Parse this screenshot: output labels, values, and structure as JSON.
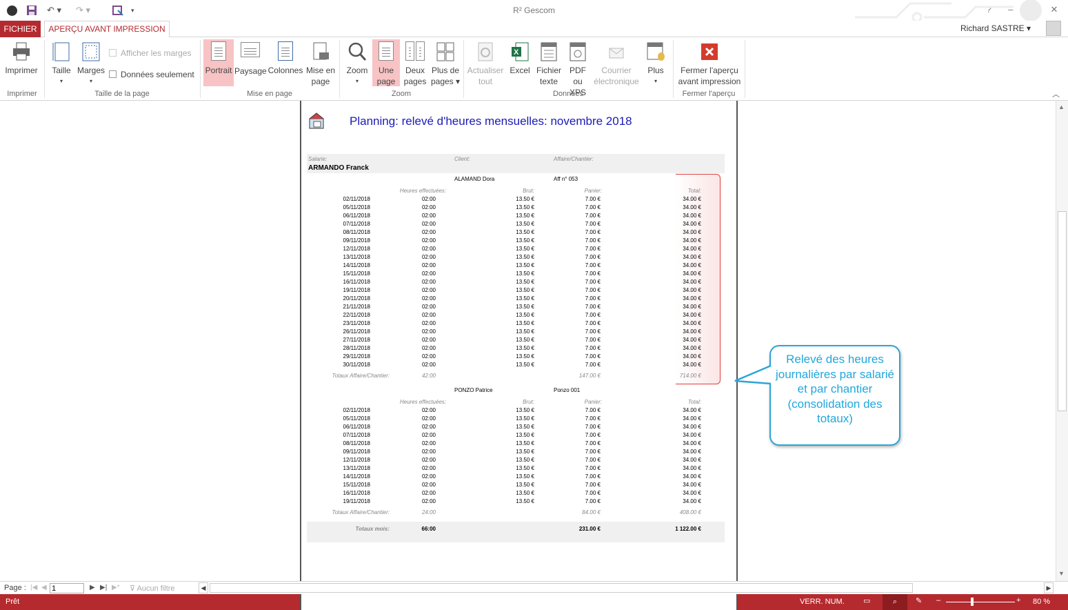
{
  "titlebar": {
    "app_title": "R² Gescom",
    "help": "?",
    "minimize": "–",
    "restore": "☐",
    "close": "✕"
  },
  "tabs": {
    "file": "FICHIER",
    "preview": "APERÇU AVANT IMPRESSION"
  },
  "user": {
    "name": "Richard SASTRE"
  },
  "ribbon": {
    "print": {
      "label": "Imprimer",
      "group": "Imprimer"
    },
    "size": {
      "label": "Taille",
      "group": "Taille de la page"
    },
    "margins": {
      "label": "Marges"
    },
    "show_margins": "Afficher les marges",
    "data_only": "Données seulement",
    "portrait": "Portrait",
    "landscape": "Paysage",
    "columns": "Colonnes",
    "page_setup_l1": "Mise en",
    "page_setup_l2": "page",
    "layout_group": "Mise en page",
    "zoom": "Zoom",
    "one_page_l1": "Une",
    "one_page_l2": "page",
    "two_pages_l1": "Deux",
    "two_pages_l2": "pages",
    "more_pages_l1": "Plus de",
    "more_pages_l2": "pages",
    "zoom_group": "Zoom",
    "refresh_l1": "Actualiser",
    "refresh_l2": "tout",
    "excel": "Excel",
    "text_file_l1": "Fichier",
    "text_file_l2": "texte",
    "pdf_l1": "PDF",
    "pdf_l2": "ou XPS",
    "email_l1": "Courrier",
    "email_l2": "électronique",
    "more": "Plus",
    "data_group": "Données",
    "close_l1": "Fermer l'aperçu",
    "close_l2": "avant impression",
    "close_group": "Fermer l'aperçu"
  },
  "report": {
    "title": "Planning: relevé d'heures mensuelles:  novembre 2018",
    "salarie_label": "Salarie:",
    "client_label": "Client:",
    "affaire_label": "Affaire/Chantier:",
    "employee": "ARMANDO Franck",
    "col_hours": "Heures effectuées:",
    "col_brut": "Brut:",
    "col_panier": "Panier:",
    "col_total": "Total:",
    "totals_label": "Totaux Affaire/Chantier:",
    "month_label": "Totaux mois:",
    "month_hours": "66:00",
    "month_panier": "231.00 €",
    "month_total": "1 122.00 €",
    "sections": [
      {
        "client": "ALAMAND Dora",
        "affaire": "Aff n° 053",
        "rows": [
          [
            "02/11/2018",
            "02:00",
            "13.50 €",
            "7.00 €",
            "34.00 €"
          ],
          [
            "05/11/2018",
            "02:00",
            "13.50 €",
            "7.00 €",
            "34.00 €"
          ],
          [
            "06/11/2018",
            "02:00",
            "13.50 €",
            "7.00 €",
            "34.00 €"
          ],
          [
            "07/11/2018",
            "02:00",
            "13.50 €",
            "7.00 €",
            "34.00 €"
          ],
          [
            "08/11/2018",
            "02:00",
            "13.50 €",
            "7.00 €",
            "34.00 €"
          ],
          [
            "09/11/2018",
            "02:00",
            "13.50 €",
            "7.00 €",
            "34.00 €"
          ],
          [
            "12/11/2018",
            "02:00",
            "13.50 €",
            "7.00 €",
            "34.00 €"
          ],
          [
            "13/11/2018",
            "02:00",
            "13.50 €",
            "7.00 €",
            "34.00 €"
          ],
          [
            "14/11/2018",
            "02:00",
            "13.50 €",
            "7.00 €",
            "34.00 €"
          ],
          [
            "15/11/2018",
            "02:00",
            "13.50 €",
            "7.00 €",
            "34.00 €"
          ],
          [
            "16/11/2018",
            "02:00",
            "13.50 €",
            "7.00 €",
            "34.00 €"
          ],
          [
            "19/11/2018",
            "02:00",
            "13.50 €",
            "7.00 €",
            "34.00 €"
          ],
          [
            "20/11/2018",
            "02:00",
            "13.50 €",
            "7.00 €",
            "34.00 €"
          ],
          [
            "21/11/2018",
            "02:00",
            "13.50 €",
            "7.00 €",
            "34.00 €"
          ],
          [
            "22/11/2018",
            "02:00",
            "13.50 €",
            "7.00 €",
            "34.00 €"
          ],
          [
            "23/11/2018",
            "02:00",
            "13.50 €",
            "7.00 €",
            "34.00 €"
          ],
          [
            "26/11/2018",
            "02:00",
            "13.50 €",
            "7.00 €",
            "34.00 €"
          ],
          [
            "27/11/2018",
            "02:00",
            "13.50 €",
            "7.00 €",
            "34.00 €"
          ],
          [
            "28/11/2018",
            "02:00",
            "13.50 €",
            "7.00 €",
            "34.00 €"
          ],
          [
            "29/11/2018",
            "02:00",
            "13.50 €",
            "7.00 €",
            "34.00 €"
          ],
          [
            "30/11/2018",
            "02:00",
            "13.50 €",
            "7.00 €",
            "34.00 €"
          ]
        ],
        "tot_hours": "42:00",
        "tot_panier": "147.00 €",
        "tot_total": "714.00 €"
      },
      {
        "client": "PONZO Patrice",
        "affaire": "Ponzo 001",
        "rows": [
          [
            "02/11/2018",
            "02:00",
            "13.50 €",
            "7.00 €",
            "34.00 €"
          ],
          [
            "05/11/2018",
            "02:00",
            "13.50 €",
            "7.00 €",
            "34.00 €"
          ],
          [
            "06/11/2018",
            "02:00",
            "13.50 €",
            "7.00 €",
            "34.00 €"
          ],
          [
            "07/11/2018",
            "02:00",
            "13.50 €",
            "7.00 €",
            "34.00 €"
          ],
          [
            "08/11/2018",
            "02:00",
            "13.50 €",
            "7.00 €",
            "34.00 €"
          ],
          [
            "09/11/2018",
            "02:00",
            "13.50 €",
            "7.00 €",
            "34.00 €"
          ],
          [
            "12/11/2018",
            "02:00",
            "13.50 €",
            "7.00 €",
            "34.00 €"
          ],
          [
            "13/11/2018",
            "02:00",
            "13.50 €",
            "7.00 €",
            "34.00 €"
          ],
          [
            "14/11/2018",
            "02:00",
            "13.50 €",
            "7.00 €",
            "34.00 €"
          ],
          [
            "15/11/2018",
            "02:00",
            "13.50 €",
            "7.00 €",
            "34.00 €"
          ],
          [
            "16/11/2018",
            "02:00",
            "13.50 €",
            "7.00 €",
            "34.00 €"
          ],
          [
            "19/11/2018",
            "02:00",
            "13.50 €",
            "7.00 €",
            "34.00 €"
          ]
        ],
        "tot_hours": "24:00",
        "tot_panier": "84.00 €",
        "tot_total": "408.00 €"
      }
    ]
  },
  "callout": {
    "text": "Relevé des heures journalières par salarié et par chantier (consolidation des totaux)"
  },
  "navbar": {
    "page_label": "Page :",
    "page_value": "1",
    "filter": "Aucun filtre"
  },
  "status": {
    "ready": "Prêt",
    "numlock": "VERR. NUM.",
    "zoom": "80 %"
  }
}
